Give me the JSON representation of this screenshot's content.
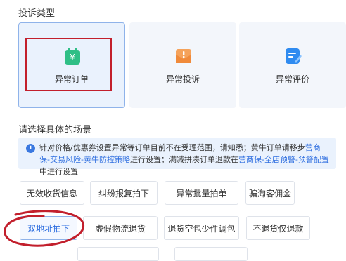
{
  "complaint_type": {
    "title": "投诉类型",
    "cards": [
      {
        "label": "异常订单",
        "selected": true,
        "icon": "yuan-bag-icon",
        "color": "#2fbf86"
      },
      {
        "label": "异常投诉",
        "selected": false,
        "icon": "alert-envelope-icon",
        "color": "#f08a3a"
      },
      {
        "label": "异常评价",
        "selected": false,
        "icon": "edit-document-icon",
        "color": "#2f8bf0"
      }
    ]
  },
  "scene": {
    "title": "请选择具体的场景",
    "notice": {
      "text1": "针对价格/优惠券设置异常等订单目前不在受理范围，请知悉；黄牛订单请移步",
      "link1": "营商保-交易风险-黄牛防控策略",
      "text2": "进行设置；满减拼凑订单退款在",
      "link2": "营商保-全店预警-预警配置",
      "text3": "中进行设置"
    },
    "chips": [
      {
        "label": "无效收货信息",
        "active": false
      },
      {
        "label": "纠纷报复拍下",
        "active": false
      },
      {
        "label": "异常批量拍单",
        "active": false
      },
      {
        "label": "骗淘客佣金",
        "active": false
      },
      {
        "label": "双地址拍下",
        "active": true
      },
      {
        "label": "虚假物流退货",
        "active": false
      },
      {
        "label": "退货空包少件调包",
        "active": false
      },
      {
        "label": "不退货仅退款",
        "active": false
      }
    ]
  },
  "colors": {
    "accent": "#2f6fe0",
    "annotation_red": "#c21f2c"
  }
}
